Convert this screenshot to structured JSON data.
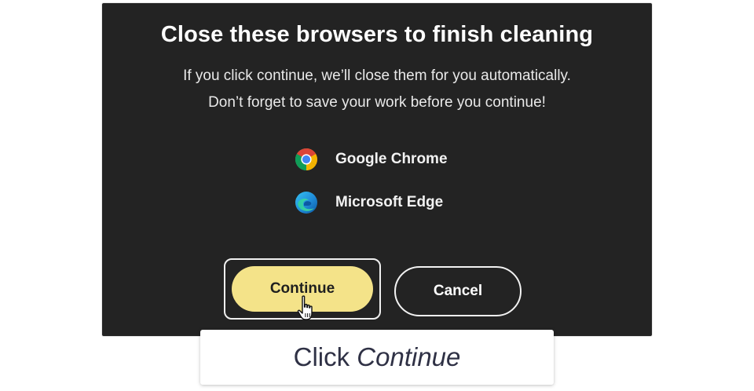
{
  "dialog": {
    "title": "Close these browsers to finish cleaning",
    "subtitle_line1": "If you click continue, we’ll close them for you automatically.",
    "subtitle_line2": "Don’t forget to save your work before you continue!",
    "browsers": [
      {
        "label": "Google Chrome",
        "icon": "chrome-icon"
      },
      {
        "label": "Microsoft Edge",
        "icon": "edge-icon"
      }
    ],
    "continue_label": "Continue",
    "cancel_label": "Cancel"
  },
  "caption": {
    "prefix": "Click",
    "emphasis": "Continue"
  },
  "colors": {
    "dialog_bg": "#232323",
    "continue_bg": "#f4e389",
    "caption_text": "#2f3145"
  }
}
